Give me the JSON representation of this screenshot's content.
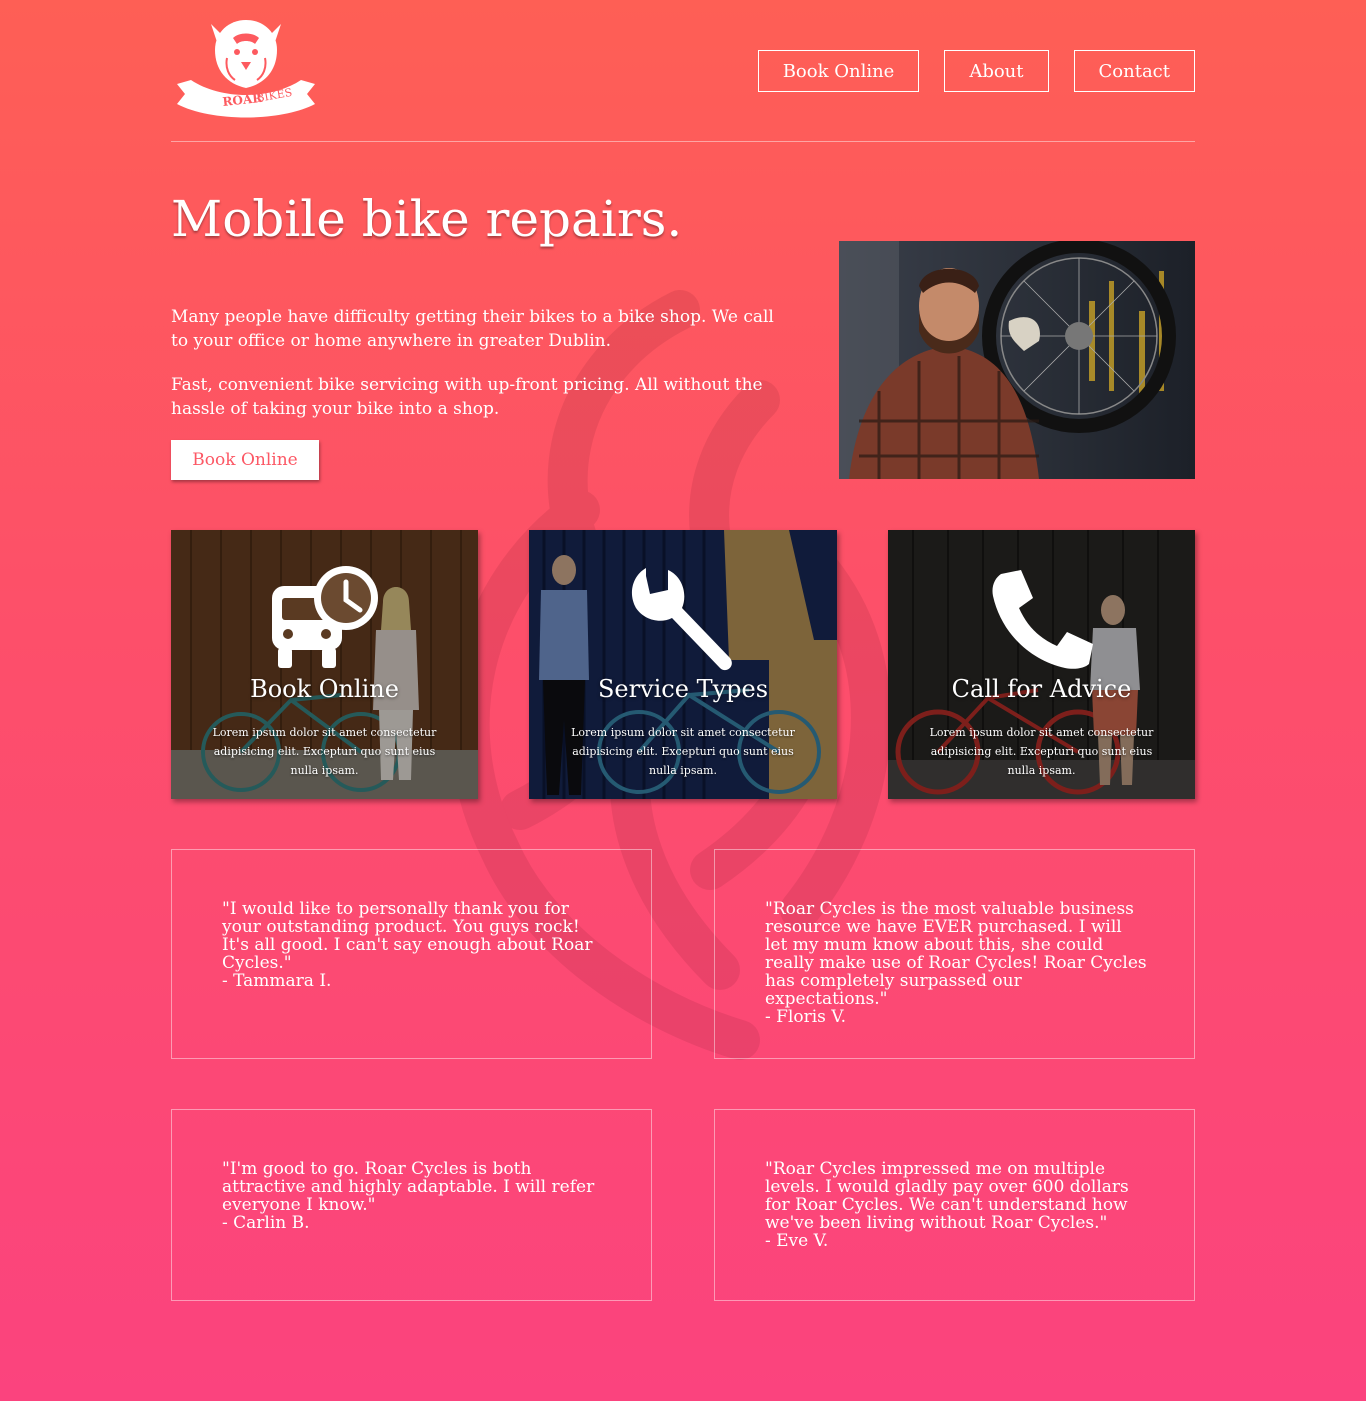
{
  "brand": {
    "name_bold": "ROAR",
    "name_light": "BIKES"
  },
  "nav": [
    {
      "label": "Book Online"
    },
    {
      "label": "About"
    },
    {
      "label": "Contact"
    }
  ],
  "hero": {
    "title": "Mobile bike repairs.",
    "paragraph_1": "Many people have difficulty getting their bikes to a bike shop. We call to your office or home anywhere in greater Dublin.",
    "paragraph_2": "Fast, convenient bike servicing with up-front pricing. All without the hassle of taking your bike into a shop.",
    "cta_label": "Book Online"
  },
  "cards": [
    {
      "title": "Book Online",
      "icon": "bus-clock-icon",
      "description": "Lorem ipsum dolor sit amet consectetur adipisicing elit. Excepturi quo sunt eius nulla ipsam."
    },
    {
      "title": "Service Types",
      "icon": "wrench-icon",
      "description": "Lorem ipsum dolor sit amet consectetur adipisicing elit. Excepturi quo sunt eius nulla ipsam."
    },
    {
      "title": "Call for Advice",
      "icon": "phone-icon",
      "description": "Lorem ipsum dolor sit amet consectetur adipisicing elit. Excepturi quo sunt eius nulla ipsam."
    }
  ],
  "testimonials": [
    {
      "quote": "\"I would like to personally thank you for your outstanding product. You guys rock! It's all good. I can't say enough about Roar Cycles.\"",
      "author": "- Tammara I."
    },
    {
      "quote": "\"Roar Cycles is the most valuable business resource we have EVER purchased. I will let my mum know about this, she could really make use of Roar Cycles! Roar Cycles has completely surpassed our expectations.\"",
      "author": "- Floris V."
    },
    {
      "quote": "\"I'm good to go. Roar Cycles is both attractive and highly adaptable. I will refer everyone I know.\"",
      "author": "- Carlin B."
    },
    {
      "quote": "\"Roar Cycles impressed me on multiple levels. I would gladly pay over 600 dollars for Roar Cycles. We can't understand how we've been living without Roar Cycles.\"",
      "author": "- Eve V."
    }
  ],
  "colors": {
    "gradient_top": "#fe5f55",
    "gradient_bottom": "#fb437e",
    "accent": "#fc5865"
  }
}
